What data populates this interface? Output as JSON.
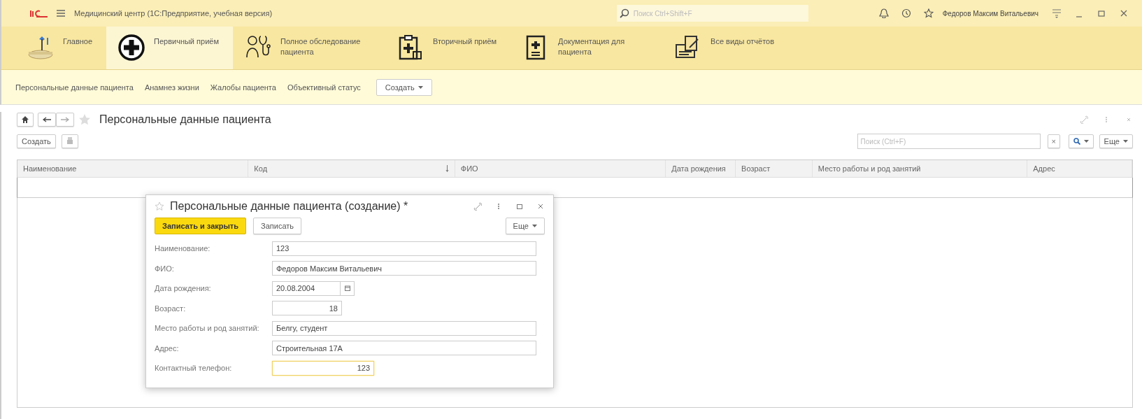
{
  "app": {
    "title": "Медицинский центр  (1С:Предприятие, учебная версия)",
    "search_placeholder": "Поиск Ctrl+Shift+F",
    "user": "Федоров Максим Витальевич"
  },
  "sections": [
    {
      "label": "Главное",
      "kind": "desk",
      "selected": false
    },
    {
      "label": "Первичный приём",
      "kind": "plus",
      "selected": true
    },
    {
      "label": "Полное обследование пациента",
      "kind": "doctor",
      "selected": false
    },
    {
      "label": "Вторичный приём",
      "kind": "clipboard",
      "selected": false
    },
    {
      "label": "Документация для пациента",
      "kind": "book",
      "selected": false
    },
    {
      "label": "Все виды отчётов",
      "kind": "reports",
      "selected": false
    }
  ],
  "commands": [
    {
      "label": "Персональные данные пациента"
    },
    {
      "label": "Анамнез жизни"
    },
    {
      "label": "Жалобы пациента"
    },
    {
      "label": "Объективный статус"
    }
  ],
  "create_menu": "Создать",
  "form": {
    "title": "Персональные данные пациента",
    "create_button": "Создать",
    "search_placeholder": "Поиск (Ctrl+F)",
    "clear": "×",
    "more": "Еще"
  },
  "table": {
    "columns": [
      {
        "label": "Наименование",
        "sorted": false
      },
      {
        "label": "Код",
        "sorted": true
      },
      {
        "label": "ФИО",
        "sorted": false
      },
      {
        "label": "Дата рождения",
        "sorted": false
      },
      {
        "label": "Возраст",
        "sorted": false
      },
      {
        "label": "Место работы и род занятий",
        "sorted": false
      },
      {
        "label": "Адрес",
        "sorted": false
      }
    ]
  },
  "dialog": {
    "title": "Персональные данные пациента (создание) *",
    "more": "Еще",
    "buttons": [
      {
        "label": "Записать и закрыть",
        "kind": "primary"
      },
      {
        "label": "Записать",
        "kind": "normal"
      }
    ],
    "fields": [
      {
        "label": "Наименование:",
        "value": "123",
        "kind": "text",
        "focused": false
      },
      {
        "label": "ФИО:",
        "value": "Федоров Максим Витальевич",
        "kind": "text",
        "focused": false
      },
      {
        "label": "Дата рождения:",
        "value": "20.08.2004",
        "kind": "date",
        "focused": false
      },
      {
        "label": "Возраст:",
        "value": "18",
        "kind": "number",
        "focused": false
      },
      {
        "label": "Место работы и род занятий:",
        "value": "Белгу, студент",
        "kind": "text",
        "focused": false
      },
      {
        "label": "Адрес:",
        "value": "Строительная 17А",
        "kind": "text",
        "focused": false
      },
      {
        "label": "Контактный телефон:",
        "value": "123",
        "kind": "phone",
        "focused": true
      }
    ]
  }
}
